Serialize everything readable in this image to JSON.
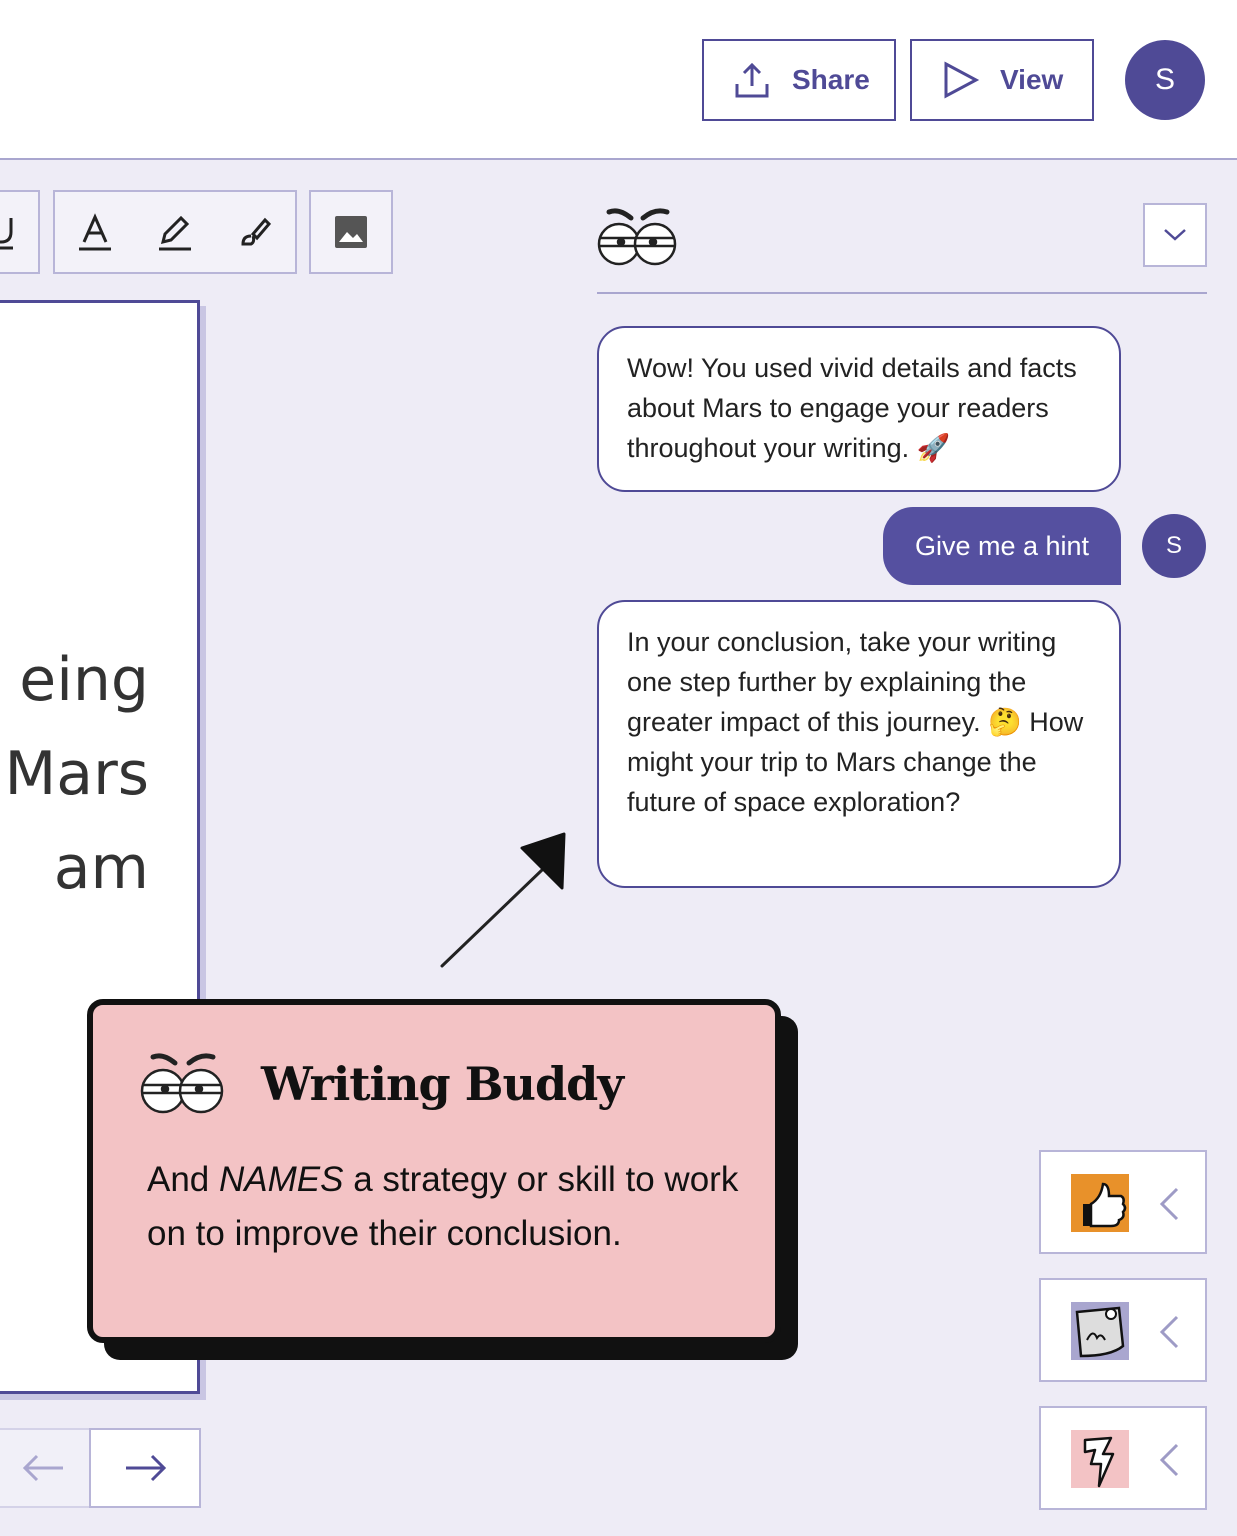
{
  "header": {
    "share_label": "Share",
    "view_label": "View",
    "user_initial": "S"
  },
  "toolbar": {
    "tools": [
      "underline-icon",
      "text-color-icon",
      "highlight-icon",
      "brush-icon",
      "image-icon"
    ]
  },
  "document": {
    "lines": [
      "eing",
      " Mars",
      "am"
    ]
  },
  "pager": {
    "prev_icon": "arrow-left-icon",
    "next_icon": "arrow-right-icon"
  },
  "chat": {
    "messages": [
      {
        "role": "bot",
        "text": "Wow! You used vivid details and facts about Mars to engage your readers throughout your writing. 🚀"
      },
      {
        "role": "user",
        "text": "Give me a hint",
        "initial": "S"
      },
      {
        "role": "bot",
        "text": "In your conclusion, take your writing one step further by explaining the greater impact of this journey. 🤔 How might your trip to Mars change the future of space exploration?"
      }
    ]
  },
  "tip": {
    "title": "Writing Buddy",
    "body_prefix": "And ",
    "body_emph": "NAMES",
    "body_suffix": " a strategy or skill to work on to improve their conclusion."
  },
  "side_panels": [
    {
      "icon": "thumbs-up-icon",
      "color": "#e8912a"
    },
    {
      "icon": "sticky-note-icon",
      "color": "#a9a6cf"
    },
    {
      "icon": "lightning-icon",
      "color": "#f3c3c5"
    }
  ],
  "colors": {
    "primary": "#4f4a96",
    "background": "#eeecf6",
    "tip_pink": "#f3c3c5"
  }
}
